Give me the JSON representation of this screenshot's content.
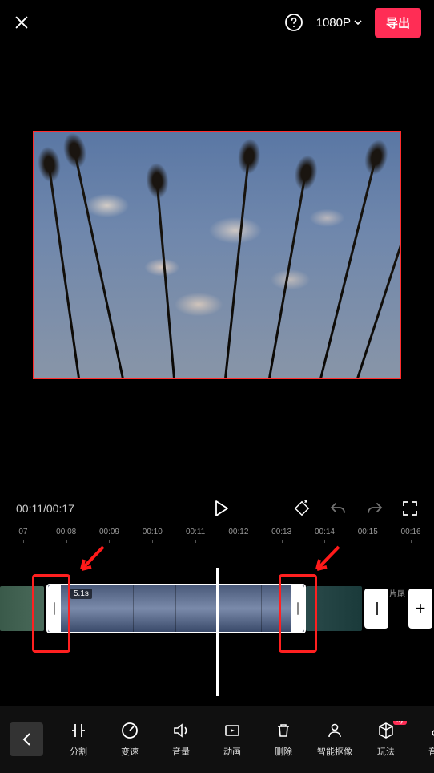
{
  "topbar": {
    "resolution": "1080P",
    "export_label": "导出"
  },
  "playback": {
    "current": "00:11",
    "total": "00:17"
  },
  "ruler_ticks": [
    "07",
    "00:08",
    "00:09",
    "00:10",
    "00:11",
    "00:12",
    "00:13",
    "00:14",
    "00:15",
    "00:16"
  ],
  "clip": {
    "duration_badge": "5.1s",
    "ending_label": "片尾"
  },
  "tools": [
    {
      "id": "split",
      "label": "分割"
    },
    {
      "id": "speed",
      "label": "变速"
    },
    {
      "id": "volume",
      "label": "音量"
    },
    {
      "id": "anim",
      "label": "动画"
    },
    {
      "id": "delete",
      "label": "删除"
    },
    {
      "id": "cutout",
      "label": "智能抠像"
    },
    {
      "id": "effects",
      "label": "玩法",
      "badge": "try"
    },
    {
      "id": "audio",
      "label": "音频"
    }
  ]
}
